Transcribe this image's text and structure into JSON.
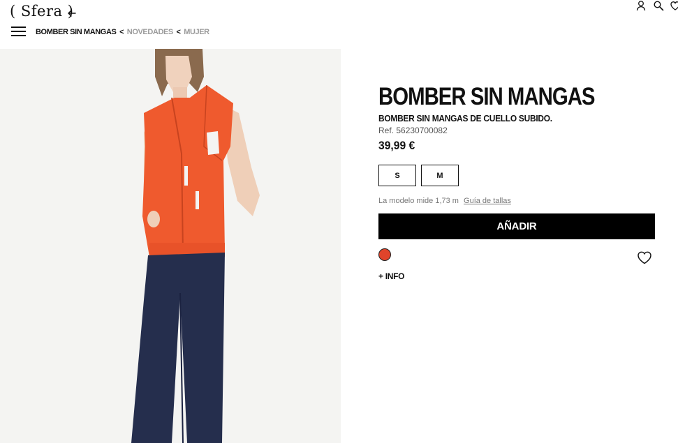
{
  "header": {
    "logo": "( Sfera )",
    "icons": [
      "arrow-left-icon",
      "user-icon",
      "search-icon",
      "heart-icon"
    ],
    "menu_icon": "hamburger-menu-icon"
  },
  "breadcrumb": {
    "current": "BOMBER SIN MANGAS",
    "separator": "<",
    "links": [
      "NOVEDADES",
      "MUJER"
    ]
  },
  "product": {
    "title": "BOMBER SIN MANGAS",
    "subtitle": "BOMBER SIN MANGAS DE CUELLO SUBIDO.",
    "ref": "Ref. 56230700082",
    "price": "39,99 €",
    "sizes": [
      "S",
      "M"
    ],
    "model_info": "La modelo mide 1,73 m",
    "size_guide": "Guía de tallas",
    "add_button": "AÑADIR",
    "color": "#e0442b",
    "more_info": "+ INFO"
  },
  "colors": {
    "accent": "#000000",
    "swatch": "#e0442b"
  }
}
